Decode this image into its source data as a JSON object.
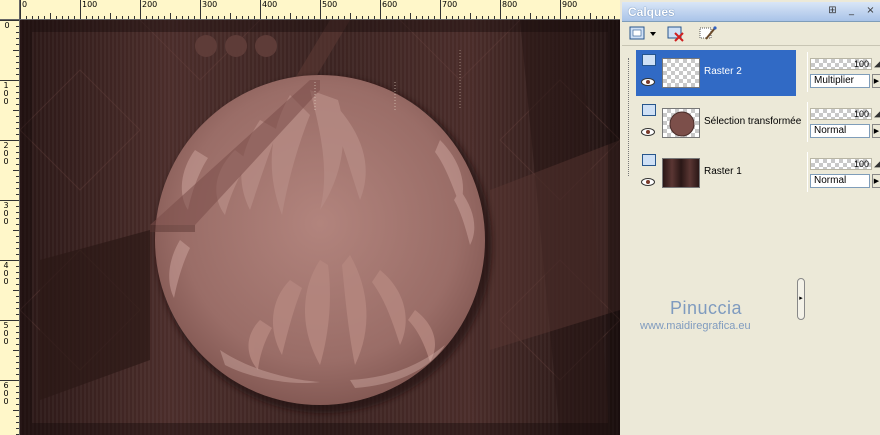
{
  "ruler": {
    "top_labels": [
      "0",
      "100",
      "200",
      "300",
      "400",
      "500",
      "600",
      "700",
      "800",
      "900"
    ],
    "left_labels": [
      "0",
      "100",
      "200",
      "300",
      "400",
      "500",
      "600"
    ]
  },
  "palette": {
    "title": "Calques",
    "pin_glyph": "⊞",
    "minimize_glyph": "_",
    "close_glyph": "×",
    "toolbar_icons": [
      "new-layer-icon",
      "delete-layer-icon",
      "edit-layer-icon"
    ],
    "layers": [
      {
        "name": "Raster 2",
        "selected": true,
        "thumb": "transparent",
        "opacity": "100",
        "blend": "Multiplier"
      },
      {
        "name": "Sélection transformée",
        "selected": false,
        "thumb": "circle",
        "opacity": "100",
        "blend": "Normal"
      },
      {
        "name": "Raster 1",
        "selected": false,
        "thumb": "dark",
        "opacity": "100",
        "blend": "Normal"
      }
    ],
    "collapse_glyph": "▸"
  },
  "watermark": {
    "name": "Pinuccia",
    "url": "www.maidiregrafica.eu"
  },
  "colors": {
    "canvas_bg": "#3d2624",
    "circle_fill": "#9a6f69",
    "selection_blue": "#316ac5",
    "ruler_bg": "#fff7c9",
    "palette_bg": "#ece9d8",
    "watermark": "#7f9bbf"
  }
}
